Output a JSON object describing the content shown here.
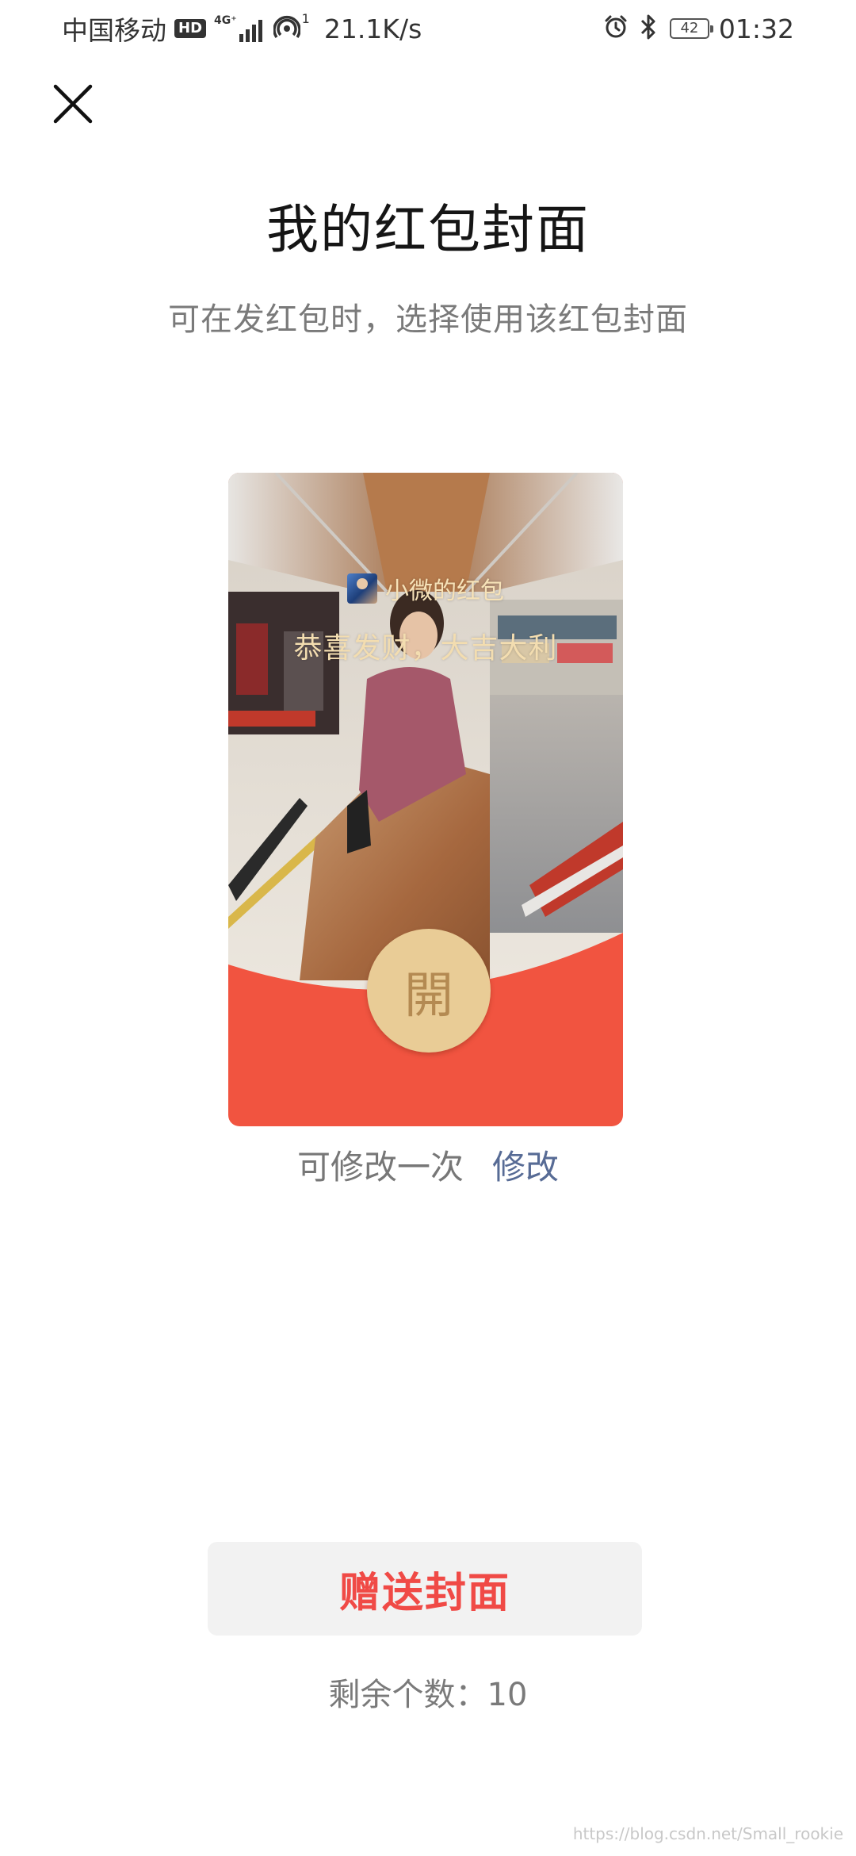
{
  "status_bar": {
    "carrier": "中国移动",
    "hd_badge": "HD",
    "network": "4G⁺",
    "hotspot_count": "1",
    "speed": "21.1K/s",
    "battery": "42",
    "time": "01:32"
  },
  "title": "我的红包封面",
  "subtitle": "可在发红包时，选择使用该红包封面",
  "cover": {
    "sender": "小微的红包",
    "blessing": "恭喜发财，大吉大利",
    "open_label": "開",
    "accent_color": "#f15440",
    "button_color": "#e9cc96"
  },
  "modify": {
    "note": "可修改一次",
    "link": "修改"
  },
  "gift_button": "赠送封面",
  "remaining": "剩余个数：10",
  "watermark": "https://blog.csdn.net/Small_rookie",
  "icons": {
    "close": "close-icon",
    "alarm": "alarm-icon",
    "bluetooth": "bluetooth-icon"
  }
}
